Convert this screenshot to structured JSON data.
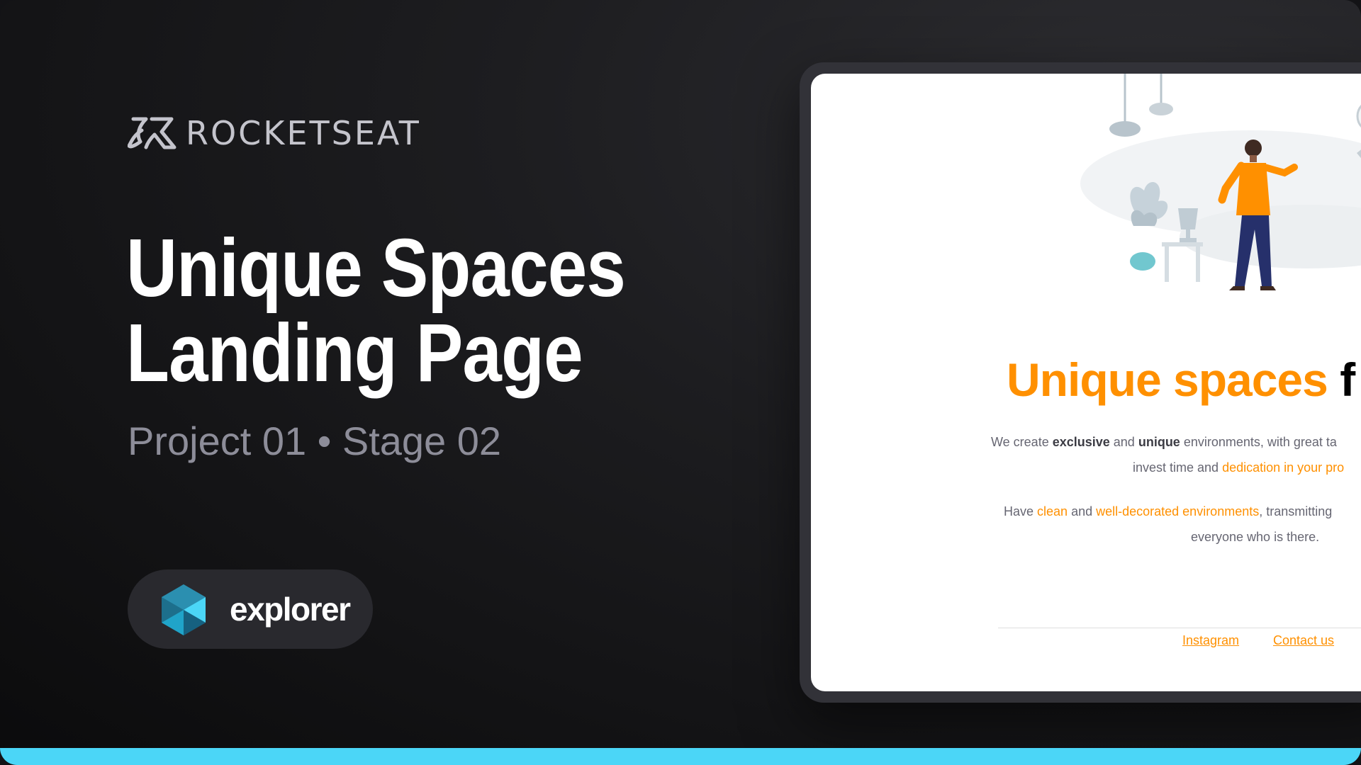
{
  "brand": {
    "name": "ROCKETSEAT",
    "icon": "rocketseat-logo-icon"
  },
  "title": {
    "line1": "Unique Spaces",
    "line2": "Landing Page"
  },
  "subtitle": "Project 01 • Stage 02",
  "badge": {
    "label": "explorer",
    "icon": "explorer-hexagon-icon"
  },
  "preview": {
    "headline": {
      "accent": "Unique spaces",
      "rest": "f"
    },
    "paragraph1": {
      "line1": {
        "t1": "We create ",
        "b1": "exclusive",
        "t2": " and ",
        "b2": "unique",
        "t3": " environments, with great ta"
      },
      "line2": {
        "t1": "invest time and ",
        "o1": "dedication in your pro"
      }
    },
    "paragraph2": {
      "line1": {
        "t1": "Have ",
        "o1": "clean",
        "t2": " and ",
        "o2": "well-decorated environments",
        "t3": ", transmitting"
      },
      "line2": {
        "t1": "everyone who is there."
      }
    },
    "footer_links": {
      "instagram": "Instagram",
      "contact": "Contact us"
    }
  },
  "colors": {
    "accent": "#ff9000",
    "bar": "#4bd6f7",
    "background": "#131316",
    "subtitle": "#8d8d99"
  }
}
